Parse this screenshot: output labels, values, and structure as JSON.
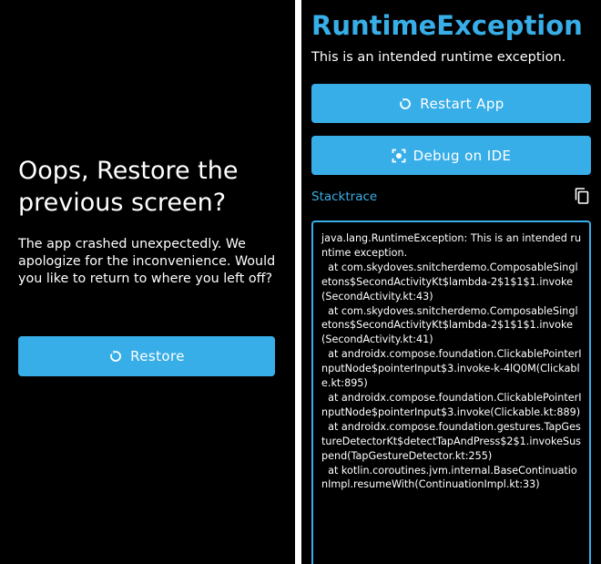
{
  "left_screen": {
    "title": "Oops, Restore the previous screen?",
    "message": "The app crashed unexpectedly. We apologize for the inconvenience. Would you like to return to where you left off?",
    "restore_button": {
      "label": "Restore",
      "icon": "refresh-icon"
    }
  },
  "right_screen": {
    "title": "RuntimeException",
    "message": "This is an intended runtime exception.",
    "restart_button": {
      "label": "Restart App",
      "icon": "refresh-icon"
    },
    "debug_button": {
      "label": "Debug on IDE",
      "icon": "focus-target-icon"
    },
    "stacktrace_label": "Stacktrace",
    "copy_icon": "copy-icon",
    "stacktrace": "java.lang.RuntimeException: This is an intended runtime exception.\n  at com.skydoves.snitcherdemo.ComposableSingletons$SecondActivityKt$lambda-2$1$1$1.invoke(SecondActivity.kt:43)\n  at com.skydoves.snitcherdemo.ComposableSingletons$SecondActivityKt$lambda-2$1$1$1.invoke(SecondActivity.kt:41)\n  at androidx.compose.foundation.ClickablePointerInputNode$pointerInput$3.invoke-k-4lQ0M(Clickable.kt:895)\n  at androidx.compose.foundation.ClickablePointerInputNode$pointerInput$3.invoke(Clickable.kt:889)\n  at androidx.compose.foundation.gestures.TapGestureDetectorKt$detectTapAndPress$2$1.invokeSuspend(TapGestureDetector.kt:255)\n  at kotlin.coroutines.jvm.internal.BaseContinuationImpl.resumeWith(ContinuationImpl.kt:33)"
  },
  "colors": {
    "accent": "#38aee8",
    "background": "#000000",
    "text": "#ffffff",
    "divider": "#ffffff"
  }
}
